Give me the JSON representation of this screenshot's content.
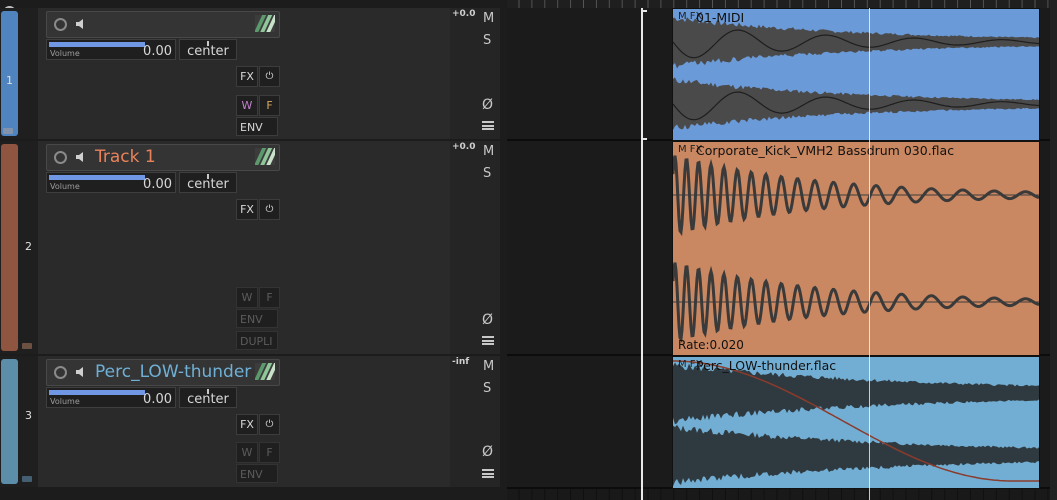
{
  "top": {
    "collapse_icon": "chevron-down-icon"
  },
  "tracks": [
    {
      "number": "1",
      "name": "",
      "name_color": "#d0d0d0",
      "color": "#4f84be",
      "volume_label": "Volume",
      "volume_value": "0.00",
      "volume_fraction": 0.75,
      "pan_value": "center",
      "fx_label": "FX",
      "power_glyph": "⏻",
      "w_label": "W",
      "f_label": "F",
      "env_label": "ENV",
      "dupli_label": "",
      "w_active": true,
      "peak": "+0.0",
      "mute": "M",
      "solo": "S",
      "phase": "Ø"
    },
    {
      "number": "2",
      "name": "Track 1",
      "name_color": "#e9825b",
      "color": "#8f5540",
      "volume_label": "Volume",
      "volume_value": "0.00",
      "volume_fraction": 0.75,
      "pan_value": "center",
      "fx_label": "FX",
      "power_glyph": "⏻",
      "w_label": "W",
      "f_label": "F",
      "env_label": "ENV",
      "dupli_label": "DUPLI",
      "w_active": false,
      "peak": "+0.0",
      "mute": "M",
      "solo": "S",
      "phase": "Ø"
    },
    {
      "number": "3",
      "name": "Perc_LOW-thunder",
      "name_color": "#6fb0d6",
      "color": "#5d8ea9",
      "volume_label": "Volume",
      "volume_value": "0.00",
      "volume_fraction": 0.75,
      "pan_value": "center",
      "fx_label": "FX",
      "power_glyph": "⏻",
      "w_label": "W",
      "f_label": "F",
      "env_label": "ENV",
      "dupli_label": "",
      "w_active": false,
      "peak": "-inf",
      "mute": "M",
      "solo": "S",
      "phase": "Ø"
    }
  ],
  "items": [
    {
      "label": "01-MIDI",
      "icons": "M FX",
      "color": "#6b9ad8",
      "wave_color": "#4a4a4a",
      "rate": ""
    },
    {
      "label": "Corporate_Kick_VMH2 Bassdrum 030.flac",
      "icons": "M FX",
      "color": "#c98862",
      "wave_color": "#3a3a3a",
      "rate": "Rate:0.020"
    },
    {
      "label": "Perc_LOW-thunder.flac",
      "icons": "M FX",
      "color": "#72aed3",
      "wave_color": "#2f3a40",
      "rate": "",
      "envelope_color": "#8a3b2b"
    }
  ]
}
